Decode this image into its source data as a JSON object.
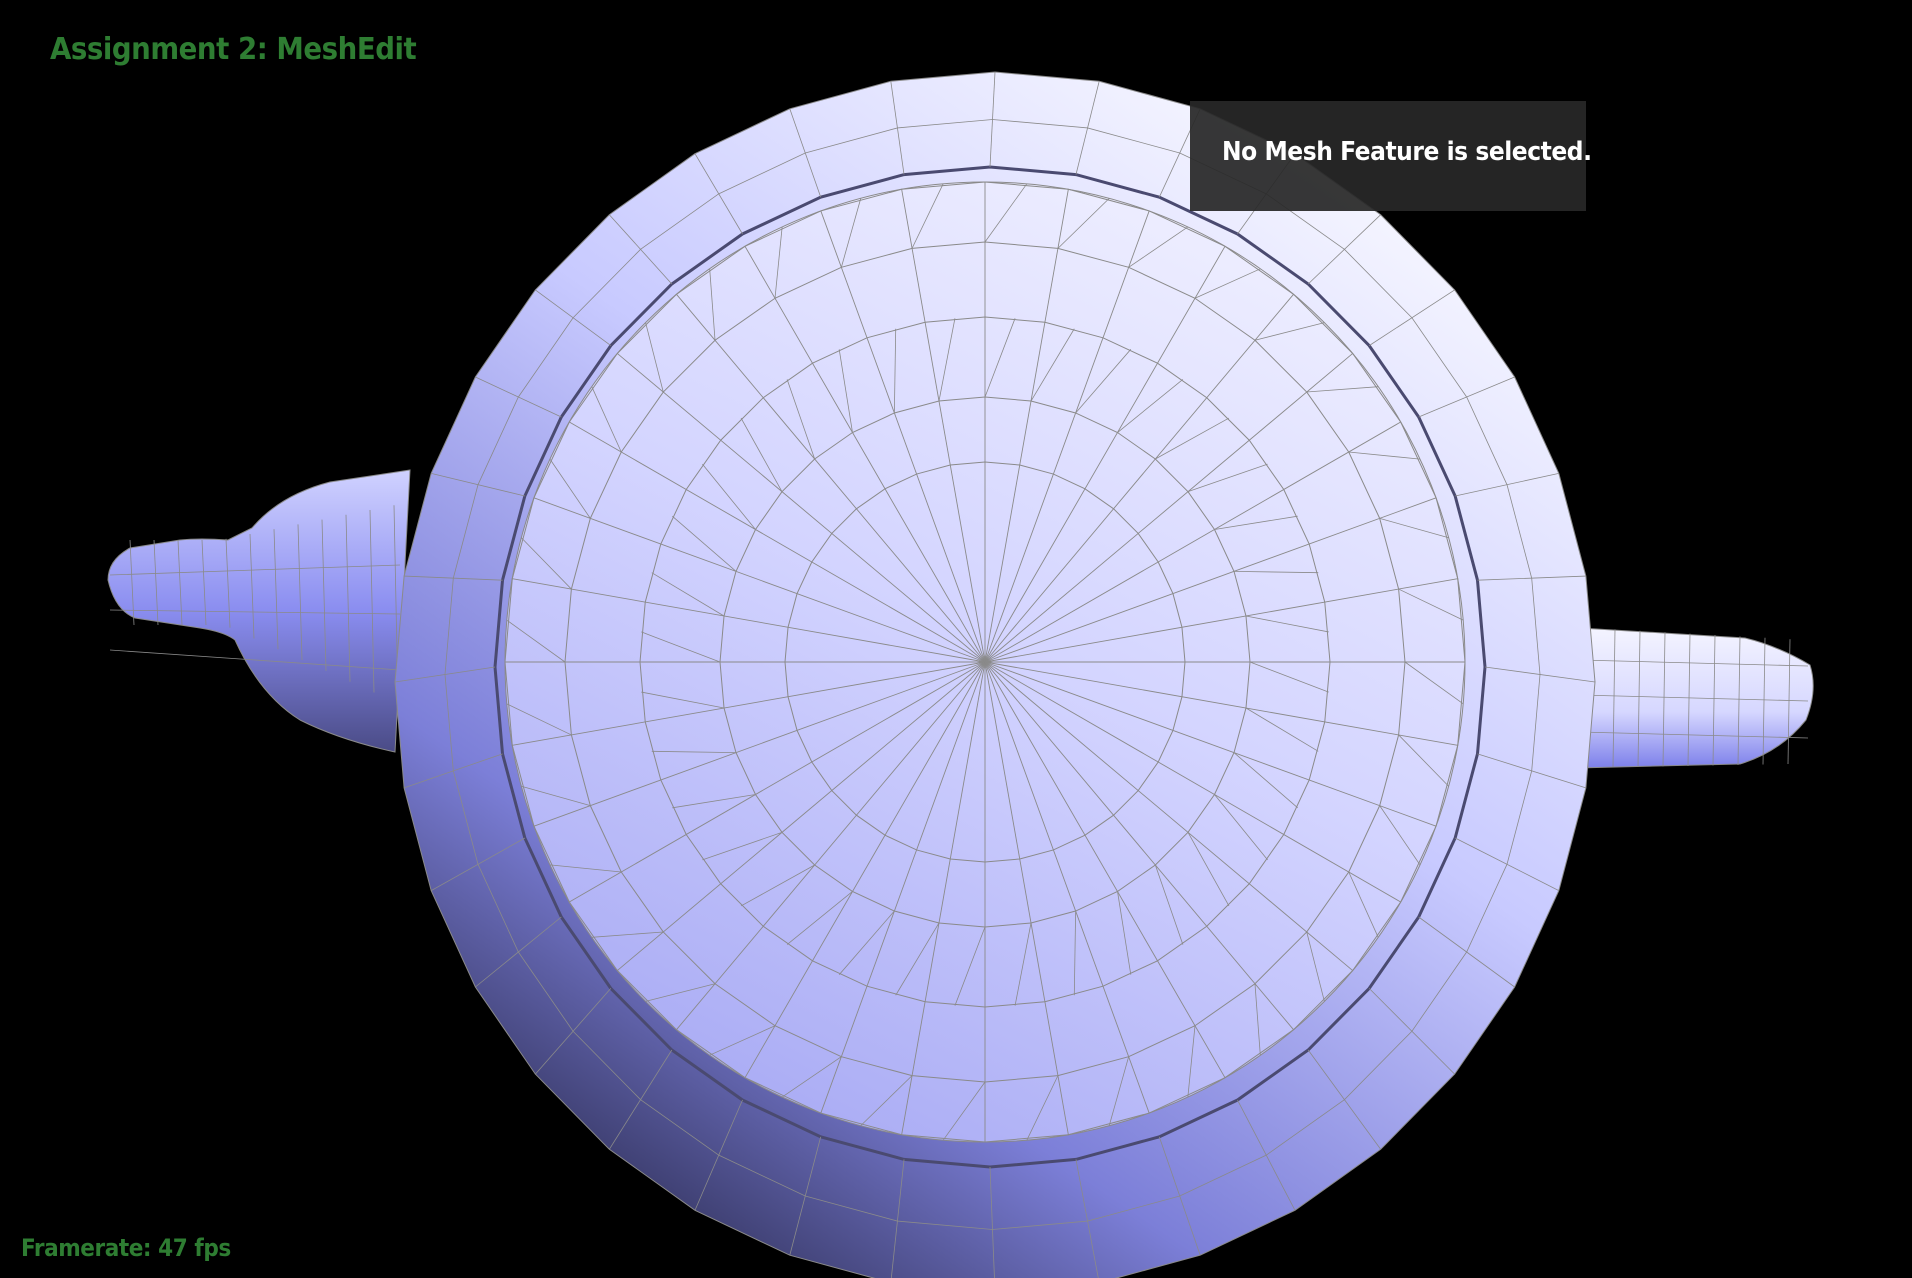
{
  "app": {
    "title": "Assignment 2: MeshEdit",
    "framerate_text": "Framerate: 47 fps"
  },
  "status_panel": {
    "message": "No Mesh Feature is selected."
  },
  "viewport": {
    "object": "teapot-mesh",
    "render_mode": "shaded-wireframe"
  },
  "colors": {
    "background": "#000000",
    "hud_text": "#2e7d32",
    "status_text": "#ffffff",
    "status_panel_bg": "#282828",
    "mesh_light": "#f5f5ff",
    "mesh_mid": "#b9bcff",
    "mesh_dark": "#3f3f70",
    "wireframe": "#8a8a8a"
  }
}
